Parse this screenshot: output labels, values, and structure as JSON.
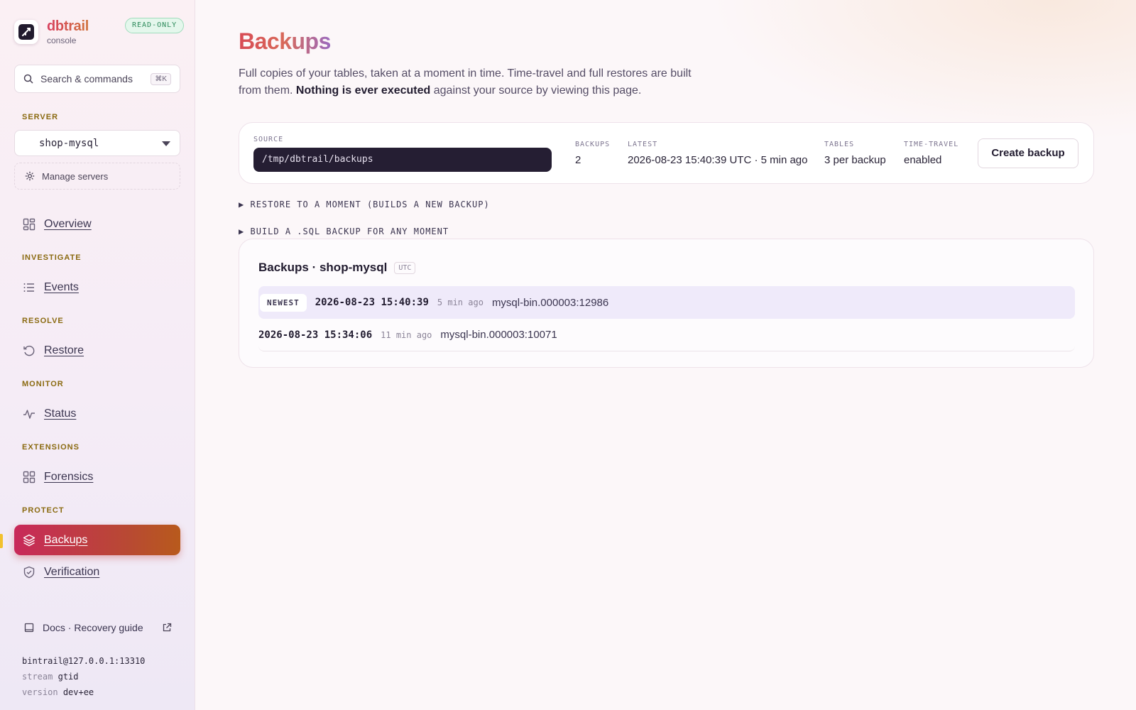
{
  "brand": {
    "name": "dbtrail",
    "sub": "console",
    "badge": "READ-ONLY"
  },
  "search": {
    "label": "Search & commands",
    "shortcut": "⌘K"
  },
  "server": {
    "section": "SERVER",
    "selected": "shop-mysql",
    "manage": "Manage servers"
  },
  "nav": {
    "overview": "Overview",
    "investigate_label": "INVESTIGATE",
    "events": "Events",
    "resolve_label": "RESOLVE",
    "restore": "Restore",
    "monitor_label": "MONITOR",
    "status": "Status",
    "extensions_label": "EXTENSIONS",
    "forensics": "Forensics",
    "protect_label": "PROTECT",
    "backups": "Backups",
    "verification": "Verification"
  },
  "footer": {
    "docs": "Docs · Recovery guide",
    "conn": "bintrail@127.0.0.1:13310",
    "stream_key": "stream",
    "stream_val": "gtid",
    "version_key": "version",
    "version_val": "dev+ee"
  },
  "page": {
    "title": "Backups",
    "desc_1": "Full copies of your tables, taken at a moment in time. Time-travel and full restores are built from them. ",
    "desc_bold": "Nothing is ever executed",
    "desc_2": " against your source by viewing this page."
  },
  "summary": {
    "source_label": "SOURCE",
    "source_value": "/tmp/dbtrail/backups",
    "backups_label": "BACKUPS",
    "backups_value": "2",
    "latest_label": "LATEST",
    "latest_value": "2026-08-23 15:40:39 UTC · 5 min ago",
    "tables_label": "TABLES",
    "tables_value": "3 per backup",
    "tt_label": "TIME-TRAVEL",
    "tt_value": "enabled",
    "create_button": "Create backup"
  },
  "disclosures": {
    "restore": "RESTORE TO A MOMENT (BUILDS A NEW BACKUP)",
    "build": "BUILD A .SQL BACKUP FOR ANY MOMENT"
  },
  "backup_list": {
    "title": "Backups · shop-mysql",
    "tz": "UTC",
    "newest_tag": "NEWEST",
    "rows": [
      {
        "timestamp": "2026-08-23 15:40:39",
        "ago": "5 min ago",
        "binlog": "mysql-bin.000003:12986"
      },
      {
        "timestamp": "2026-08-23 15:34:06",
        "ago": "11 min ago",
        "binlog": "mysql-bin.000003:10071"
      }
    ]
  }
}
